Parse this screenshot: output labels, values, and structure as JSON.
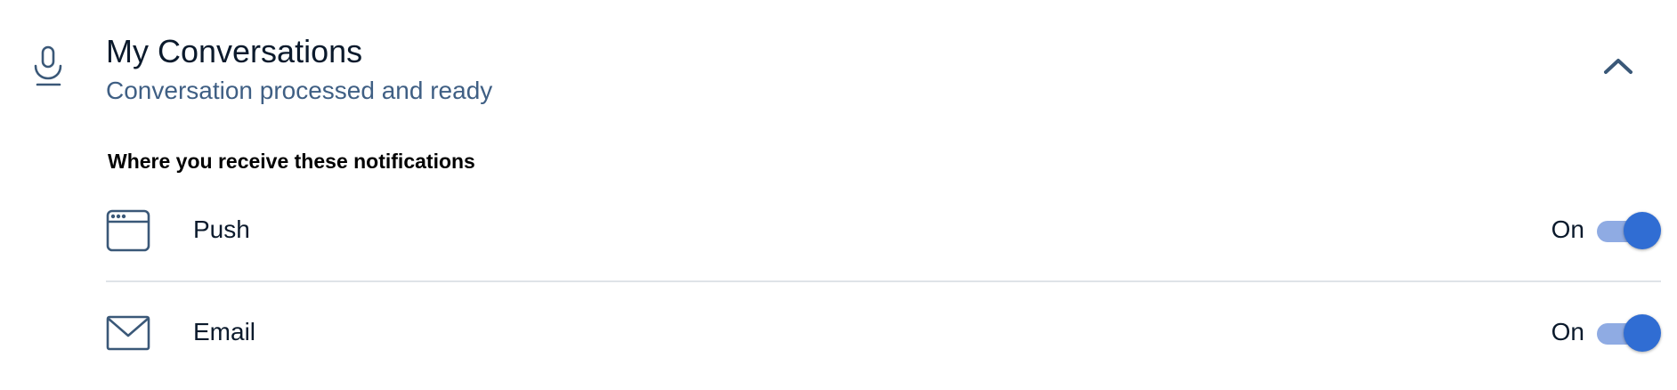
{
  "section": {
    "icon": "microphone-icon",
    "title": "My Conversations",
    "subtitle": "Conversation processed and ready",
    "collapse_icon": "chevron-up-icon"
  },
  "notifications": {
    "heading": "Where you receive these notifications",
    "channels": [
      {
        "icon": "browser-window-icon",
        "label": "Push",
        "state": "On",
        "enabled": true
      },
      {
        "icon": "envelope-icon",
        "label": "Email",
        "state": "On",
        "enabled": true
      }
    ]
  },
  "colors": {
    "title_text": "#0b1a2c",
    "subtitle_text": "#3f5f84",
    "icon_stroke": "#3a5878",
    "toggle_track_on": "#8fabe3",
    "toggle_thumb_on": "#306dd3",
    "divider": "#dfe3e8"
  }
}
